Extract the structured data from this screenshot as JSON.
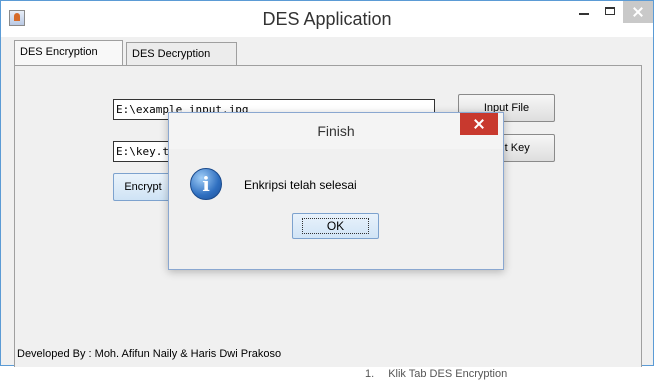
{
  "window": {
    "title": "DES Application"
  },
  "tabs": [
    {
      "label": "DES Encryption",
      "active": true
    },
    {
      "label": "DES Decryption",
      "active": false
    }
  ],
  "encryption": {
    "input_path": "E:\\example_input.jpg",
    "key_path": "E:\\key.txt",
    "input_file_button": "Input File",
    "input_key_button": "Input Key",
    "encrypt_button": "Encrypt"
  },
  "footer": {
    "credits": "Developed By : Moh. Afifun Naily & Haris Dwi Prakoso"
  },
  "dialog": {
    "title": "Finish",
    "message": "Enkripsi telah selesai",
    "ok_label": "OK",
    "icon": "info-icon"
  },
  "document_below": {
    "number": "1.",
    "text": "Klik Tab DES Encryption"
  },
  "colors": {
    "window_border": "#5b9bd5",
    "dialog_close": "#c8392e",
    "info_icon": "#2f6fc0"
  }
}
